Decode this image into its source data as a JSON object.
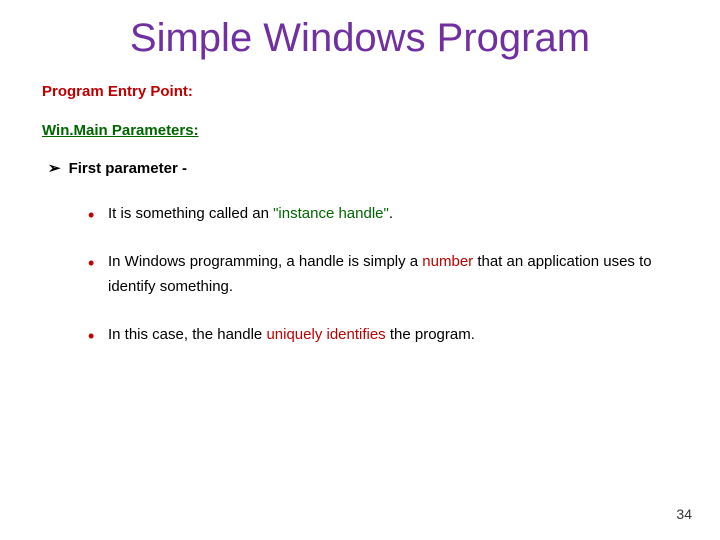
{
  "title": "Simple Windows Program",
  "section_heading": "Program Entry Point:",
  "subsection_heading": "Win.Main Parameters:",
  "arrow_item": "First parameter -",
  "bullets": [
    {
      "pre": "It is something called an ",
      "hl": "\"instance handle\"",
      "hl_class": "hl-green",
      "post": "."
    },
    {
      "pre": "In Windows programming, a handle is simply a ",
      "hl": "number",
      "hl_class": "hl-red",
      "post": " that an application uses to identify something."
    },
    {
      "pre": "In this case, the handle ",
      "hl": "uniquely identifies",
      "hl_class": "hl-red",
      "post": " the program."
    }
  ],
  "page_number": "34"
}
